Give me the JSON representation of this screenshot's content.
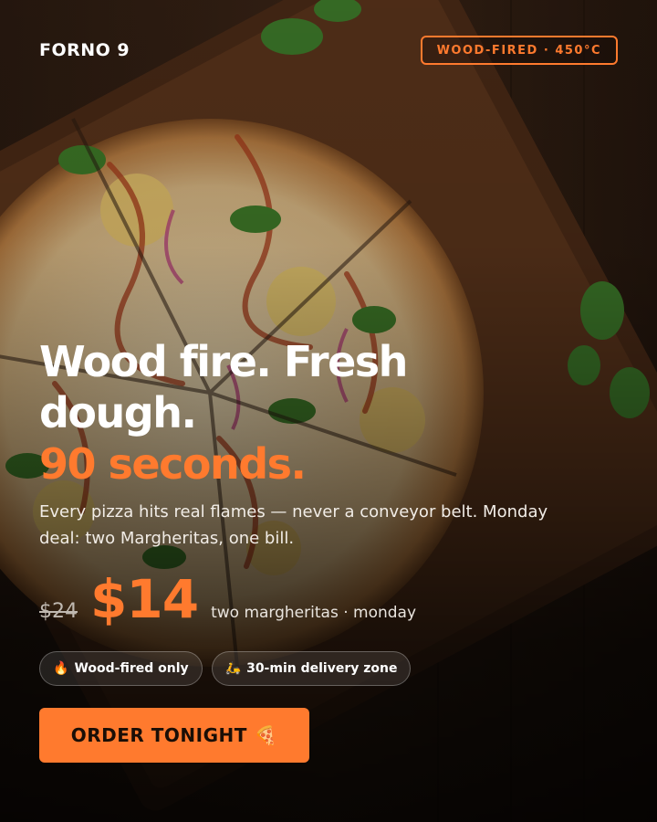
{
  "brand": {
    "logo_text": "FORNO 9"
  },
  "badge": {
    "text": "WOOD-FIRED · 450°C"
  },
  "hero": {
    "headline_line1": "Wood fire. Fresh dough.",
    "headline_accent": "90 seconds.",
    "subtext": "Every pizza hits real flames — never a conveyor belt. Monday deal: two Margheritas, one bill."
  },
  "pricing": {
    "old_price": "$24",
    "new_price": "$14",
    "note": "two margheritas · monday"
  },
  "chips": [
    {
      "icon": "flame-icon",
      "glyph": "🔥",
      "label": "Wood-fired only"
    },
    {
      "icon": "scooter-icon",
      "glyph": "🛵",
      "label": "30-min delivery zone"
    }
  ],
  "cta": {
    "label": "ORDER TONIGHT",
    "icon": "pizza-icon",
    "glyph": "🍕"
  },
  "colors": {
    "accent": "#ff7a2e",
    "background": "#1a120c",
    "text": "#ffffff"
  },
  "background_image": {
    "subject": "pizza-photo"
  }
}
